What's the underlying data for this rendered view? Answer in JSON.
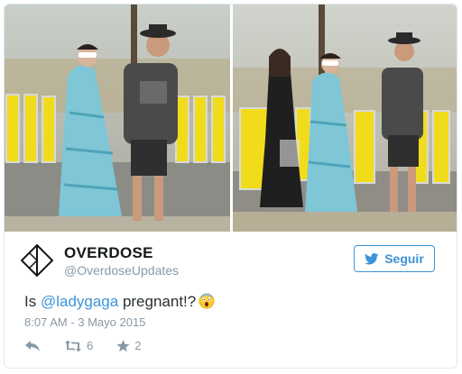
{
  "account": {
    "display_name": "OVERDOSE",
    "handle": "@OverdoseUpdates"
  },
  "follow_button": {
    "label": "Seguir"
  },
  "tweet": {
    "prefix": "Is ",
    "mention": "@ladygaga",
    "suffix": " pregnant!?",
    "emoji": "face-screaming-in-fear",
    "timestamp": "8:07 AM - 3 Mayo 2015"
  },
  "actions": {
    "reply_icon": "reply-icon",
    "retweet_count": "6",
    "favorite_count": "2"
  },
  "colors": {
    "link": "#3b94d9",
    "muted": "#8899a6",
    "text": "#292f33"
  }
}
